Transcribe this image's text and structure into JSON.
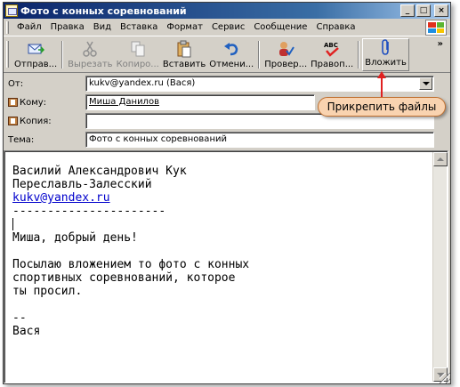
{
  "window": {
    "title": "Фото с конных соревнований"
  },
  "menu": [
    "Файл",
    "Правка",
    "Вид",
    "Вставка",
    "Формат",
    "Сервис",
    "Сообщение",
    "Справка"
  ],
  "toolbar": {
    "send": "Отправ...",
    "cut": "Вырезать",
    "copy": "Копиро...",
    "paste": "Вставить",
    "undo": "Отмени...",
    "check": "Провер...",
    "spell": "Правоп...",
    "attach": "Вложить"
  },
  "fields": {
    "from_label": "От:",
    "from_value": "kukv@yandex.ru   (Вася)",
    "to_label": "Кому:",
    "to_value": "Миша Данилов",
    "cc_label": "Копия:",
    "cc_value": "",
    "subject_label": "Тема:",
    "subject_value": "Фото с конных соревнований"
  },
  "body": {
    "line1": "Василий Александрович Кук",
    "line2": "Переславль-Залесский",
    "email_link": "kukv@yandex.ru",
    "separator": "----------------------",
    "greeting": "Миша, добрый день!",
    "para1": "Посылаю вложением то фото с конных",
    "para2": "спортивных соревнований, которое",
    "para3": "ты просил.",
    "sig_dash": "--",
    "sig_name": "Вася"
  },
  "callout": {
    "text": "Прикрепить файлы"
  },
  "colors": {
    "titlebar": "#0a246a",
    "callout_bg": "#f9d3b0",
    "arrow": "#e02020",
    "link": "#0000cc"
  }
}
